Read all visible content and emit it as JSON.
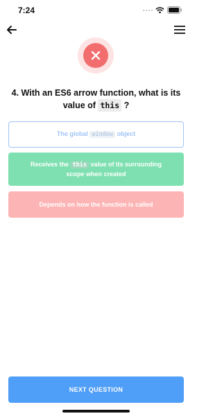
{
  "status_bar": {
    "time": "7:24"
  },
  "nav": {
    "back_icon": "arrow-left-icon",
    "menu_icon": "hamburger-menu-icon"
  },
  "result": {
    "state": "incorrect",
    "icon": "close-icon",
    "color": "#f26d6d"
  },
  "question": {
    "prefix": "4. With an ES6 arrow function, what is its value of",
    "code": "this",
    "suffix": "?"
  },
  "answers": [
    {
      "state": "selected-disabled",
      "text_before": "The global",
      "code": "window",
      "text_after": "object"
    },
    {
      "state": "correct",
      "text_before": "Receives the",
      "code": "this",
      "text_after": "value of its surrounding scope when created"
    },
    {
      "state": "incorrect",
      "text": "Depends on how the function is called"
    }
  ],
  "next_button": {
    "label": "NEXT QUESTION"
  },
  "colors": {
    "accent": "#4f9ef7",
    "correct": "#7ee0b0",
    "incorrect": "#fdb4b4",
    "outline": "#9fc4f7"
  }
}
